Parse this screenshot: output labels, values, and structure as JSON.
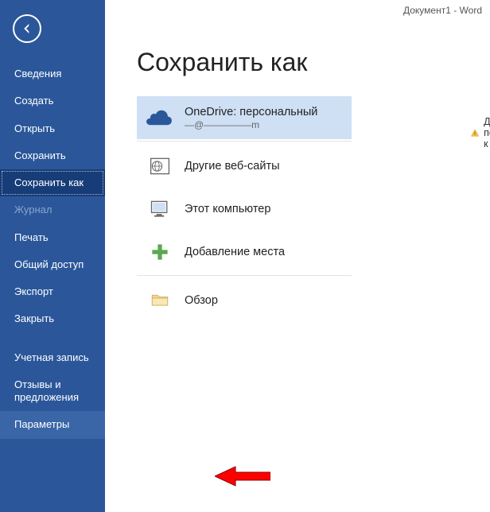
{
  "titlebar": {
    "text": "Документ1 - Word"
  },
  "page": {
    "title": "Сохранить как"
  },
  "sidebar": {
    "items": [
      {
        "label": "Сведения"
      },
      {
        "label": "Создать"
      },
      {
        "label": "Открыть"
      },
      {
        "label": "Сохранить"
      },
      {
        "label": "Сохранить как"
      },
      {
        "label": "Журнал"
      },
      {
        "label": "Печать"
      },
      {
        "label": "Общий доступ"
      },
      {
        "label": "Экспорт"
      },
      {
        "label": "Закрыть"
      },
      {
        "label": "Учетная запись"
      },
      {
        "label": "Отзывы и предложения"
      },
      {
        "label": "Параметры"
      }
    ]
  },
  "locations": {
    "items": [
      {
        "title": "OneDrive: персональный",
        "sub": "—@—————m"
      },
      {
        "title": "Другие веб-сайты"
      },
      {
        "title": "Этот компьютер"
      },
      {
        "title": "Добавление места"
      },
      {
        "title": "Обзор"
      }
    ]
  },
  "warning": {
    "text": "Для подключения к"
  }
}
